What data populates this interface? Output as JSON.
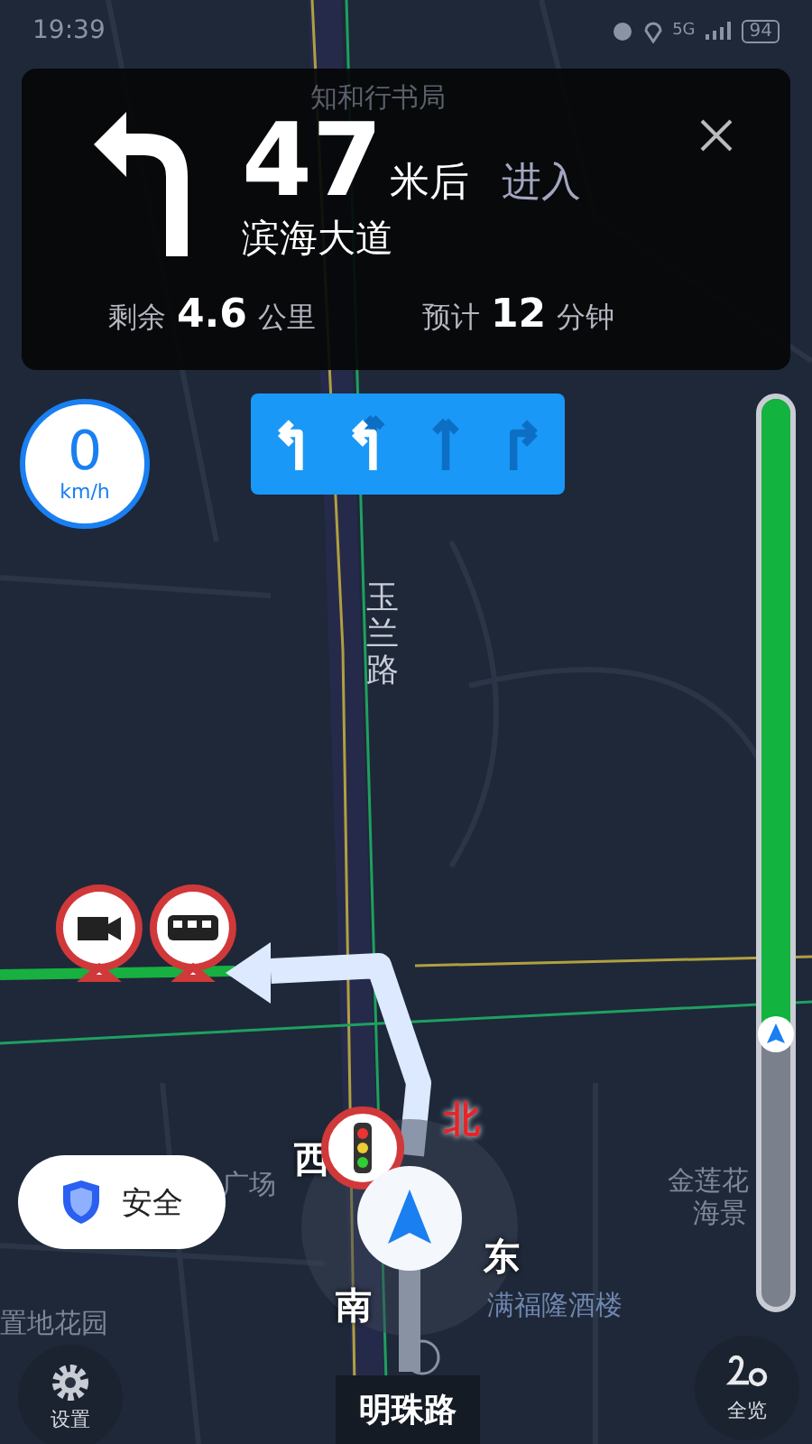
{
  "status_bar": {
    "time": "19:39",
    "network": "5G",
    "battery": "94"
  },
  "guidance": {
    "distance": "47",
    "unit": "米后",
    "action": "进入",
    "road": "滨海大道",
    "remaining_label": "剩余",
    "remaining_value": "4.6",
    "remaining_unit": "公里",
    "eta_label": "预计",
    "eta_value": "12",
    "eta_unit": "分钟"
  },
  "speed": {
    "value": "0",
    "unit": "km/h"
  },
  "lanes": [
    {
      "kind": "left",
      "selected": true
    },
    {
      "kind": "left-straight",
      "selected": true
    },
    {
      "kind": "straight",
      "selected": false
    },
    {
      "kind": "right",
      "selected": false
    }
  ],
  "route_progress": {
    "level": 0.7
  },
  "map": {
    "labels": [
      "知和行书局",
      "玉兰路",
      "广场",
      "金莲花",
      "海景",
      "满福隆酒楼",
      "置地花园"
    ],
    "compass": [
      {
        "kind": "north",
        "text": "北"
      },
      {
        "kind": "west",
        "text": "西"
      },
      {
        "kind": "south",
        "text": "南"
      },
      {
        "kind": "east",
        "text": "东"
      }
    ]
  },
  "safety_button": {
    "label": "安全"
  },
  "current_road": "明珠路",
  "bottom_buttons": [
    {
      "kind": "settings",
      "label": "设置"
    },
    {
      "kind": "overview",
      "label": "全览"
    }
  ]
}
